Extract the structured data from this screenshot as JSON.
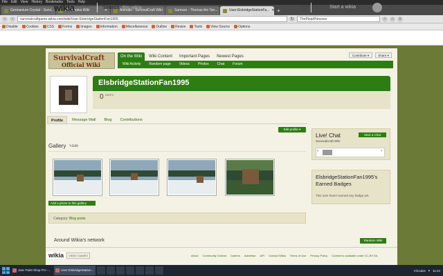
{
  "os": {
    "menu": [
      "File",
      "Edit",
      "View",
      "History",
      "Bookmarks",
      "Tools",
      "Help"
    ]
  },
  "browser": {
    "tabs": [
      {
        "title": "Germanium Crystal - Survi...",
        "active": false
      },
      {
        "title": "31 Minutos Wiki",
        "active": false
      },
      {
        "title": "Animals - SurvivalCraft Wiki",
        "active": false
      },
      {
        "title": "Samson - Thomas the Tan...",
        "active": false
      },
      {
        "title": "User:ElsbridgeStationFa...",
        "active": true
      }
    ],
    "url": "survivalcraftgame.wikia.com/wiki/User:ElsbridgeStationFan1995",
    "search_value": "ThePixarPrincess",
    "bookmarks": [
      "Disable",
      "Cookies",
      "CSS",
      "Forms",
      "Images",
      "Information",
      "Miscellaneous",
      "Outline",
      "Resize",
      "Tools",
      "View Source",
      "Options"
    ]
  },
  "wikia": {
    "logo": "wikia",
    "search_label": "Search",
    "search_placeholder": "this wikia",
    "start_wikia": "Start a wikia"
  },
  "wiki": {
    "logo_line1": "SurvivalCraft",
    "logo_line2": "Official Wiki",
    "nav": [
      "On the Wiki",
      "Wiki Content",
      "Important Pages",
      "Newest Pages"
    ],
    "subnav": [
      "Wiki Activity",
      "Random page",
      "Videos",
      "Photos",
      "Chat",
      "Forum"
    ],
    "contribute": "Contribute ▾",
    "share": "Share ▾"
  },
  "profile": {
    "username": "ElsbridgeStationFan1995",
    "edit_count": "0",
    "edit_label": "EDITS",
    "tabs": [
      "Profile",
      "Message Wall",
      "Blog",
      "Contributions"
    ],
    "edit_profile": "Edit profile ▾",
    "gallery_title": "Gallery",
    "gallery_edit": "Edit",
    "add_photo": "Add a photo to this gallery",
    "category_label": "Category:",
    "category_value": "Blog posts"
  },
  "rail": {
    "chat_title": "Live! Chat",
    "chat_sub": "SurvivalCraft Wiki",
    "start_chat": "Start a Chat",
    "chat_prev": "‹",
    "chat_next": "›",
    "badge_title": "ElsbridgeStationFan1995's Earned Badges",
    "badge_text": "This user hasn't earned any badge yet."
  },
  "footer": {
    "network": "Around Wikia's network",
    "random_wiki": "Random Wiki",
    "logo": "wikia",
    "video_games": "VIDEO GAMES",
    "links": [
      "About",
      "Community Central",
      "Careers",
      "Advertise",
      "API",
      "Contact Wikia",
      "Terms of Use",
      "Privacy Policy",
      "Content is available under CC-BY-SA."
    ]
  },
  "taskbar": {
    "items": [
      "Jasc Paint Shop Pro -...",
      "User:ElsbridgeStation..."
    ],
    "tray_label": "Vínculos",
    "clock": "11:24"
  }
}
